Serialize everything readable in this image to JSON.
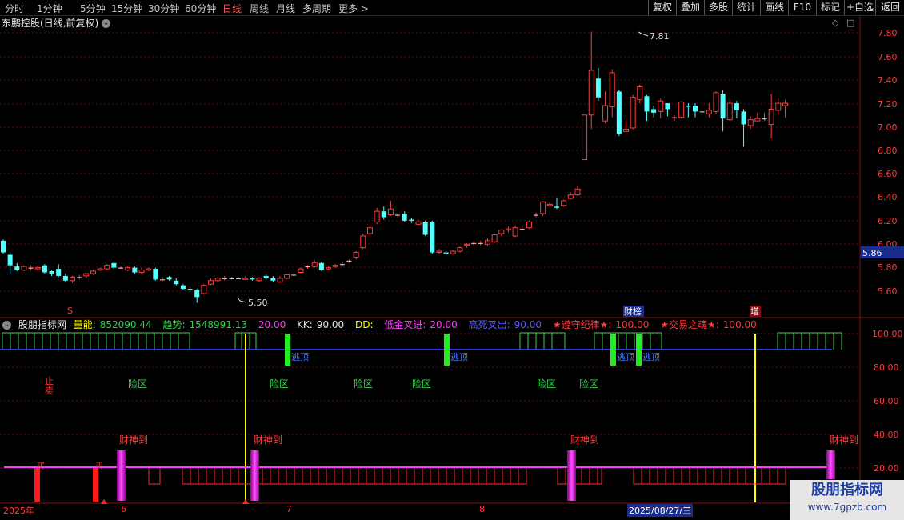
{
  "topbar": {
    "periods": [
      "分时",
      "1分钟",
      "5分钟",
      "15分钟",
      "30分钟",
      "60分钟",
      "日线",
      "周线",
      "月线",
      "多周期",
      "更多 >"
    ],
    "active_period": "日线",
    "buttons": [
      "复权",
      "叠加",
      "多股",
      "统计",
      "画线",
      "F10",
      "标记",
      "+自选",
      "返回"
    ]
  },
  "title": {
    "stock": "东鹏控股(日线,前复权)"
  },
  "price_axis": [
    "7.80",
    "7.60",
    "7.40",
    "7.20",
    "7.00",
    "6.80",
    "6.60",
    "6.40",
    "6.20",
    "6.00",
    "5.80",
    "5.60"
  ],
  "current_price": "5.86",
  "annotations": {
    "high": "7.81",
    "low": "5.50",
    "mark_s": "S",
    "tag_caibang": "财榜",
    "tag_zeng": "增"
  },
  "indicator": {
    "name": "股朋指标网",
    "items": [
      {
        "label": "量能:",
        "value": "852090.44"
      },
      {
        "label": "趋势:",
        "value": "1548991.13"
      },
      {
        "label": "",
        "value": "20.00"
      },
      {
        "label": "KK:",
        "value": "90.00"
      },
      {
        "label": "DD:",
        "value": ""
      },
      {
        "label": "低金叉进:",
        "value": "20.00"
      },
      {
        "label": "高死叉出:",
        "value": "90.00"
      },
      {
        "label": "★遵守纪律★:",
        "value": "100.00"
      },
      {
        "label": "★交易之魂★:",
        "value": "100.00"
      }
    ],
    "axis": [
      "100.00",
      "80.00",
      "60.00",
      "40.00",
      "20.00"
    ],
    "texts": {
      "risk": "险区",
      "top": "逃顶",
      "stop": "止卖",
      "buy": "买",
      "wealth": "财神到"
    }
  },
  "date_axis": {
    "start": "2025年",
    "m6": "6",
    "m7": "7",
    "m8": "8",
    "cursor": "2025/08/27/三"
  },
  "watermark": {
    "line1": "股朋指标网",
    "line2": "www.7gpzb.com"
  },
  "chart_data": {
    "type": "candlestick",
    "ylim": [
      5.45,
      7.9
    ],
    "candles": [
      [
        6.03,
        5.93,
        6.04,
        5.92
      ],
      [
        5.91,
        5.82,
        5.93,
        5.75
      ],
      [
        5.81,
        5.78,
        5.84,
        5.77
      ],
      [
        5.78,
        5.81,
        5.82,
        5.77
      ],
      [
        5.8,
        5.8,
        5.82,
        5.78
      ],
      [
        5.79,
        5.8,
        5.82,
        5.77
      ],
      [
        5.82,
        5.76,
        5.83,
        5.75
      ],
      [
        5.77,
        5.75,
        5.78,
        5.73
      ],
      [
        5.79,
        5.73,
        5.83,
        5.72
      ],
      [
        5.73,
        5.69,
        5.75,
        5.68
      ],
      [
        5.69,
        5.72,
        5.73,
        5.67
      ],
      [
        5.72,
        5.72,
        5.74,
        5.7
      ],
      [
        5.73,
        5.75,
        5.75,
        5.71
      ],
      [
        5.75,
        5.77,
        5.78,
        5.74
      ],
      [
        5.78,
        5.79,
        5.8,
        5.77
      ],
      [
        5.79,
        5.82,
        5.83,
        5.78
      ],
      [
        5.84,
        5.8,
        5.85,
        5.79
      ],
      [
        5.8,
        5.8,
        5.81,
        5.79
      ],
      [
        5.78,
        5.8,
        5.81,
        5.77
      ],
      [
        5.8,
        5.76,
        5.81,
        5.75
      ],
      [
        5.76,
        5.78,
        5.8,
        5.75
      ],
      [
        5.78,
        5.79,
        5.8,
        5.77
      ],
      [
        5.79,
        5.7,
        5.8,
        5.69
      ],
      [
        5.7,
        5.7,
        5.72,
        5.68
      ],
      [
        5.72,
        5.7,
        5.73,
        5.69
      ],
      [
        5.69,
        5.66,
        5.71,
        5.65
      ],
      [
        5.65,
        5.62,
        5.66,
        5.61
      ],
      [
        5.62,
        5.61,
        5.63,
        5.6
      ],
      [
        5.61,
        5.55,
        5.62,
        5.5
      ],
      [
        5.58,
        5.65,
        5.66,
        5.57
      ],
      [
        5.66,
        5.69,
        5.71,
        5.65
      ],
      [
        5.69,
        5.71,
        5.72,
        5.68
      ],
      [
        5.71,
        5.71,
        5.73,
        5.69
      ],
      [
        5.71,
        5.71,
        5.72,
        5.7
      ],
      [
        5.71,
        5.71,
        5.72,
        5.7
      ],
      [
        5.7,
        5.71,
        5.73,
        5.7
      ],
      [
        5.71,
        5.7,
        5.72,
        5.69
      ],
      [
        5.69,
        5.71,
        5.72,
        5.68
      ],
      [
        5.73,
        5.71,
        5.74,
        5.7
      ],
      [
        5.71,
        5.69,
        5.73,
        5.68
      ],
      [
        5.68,
        5.71,
        5.73,
        5.67
      ],
      [
        5.71,
        5.74,
        5.75,
        5.7
      ],
      [
        5.74,
        5.74,
        5.76,
        5.73
      ],
      [
        5.76,
        5.79,
        5.8,
        5.75
      ],
      [
        5.81,
        5.81,
        5.82,
        5.79
      ],
      [
        5.81,
        5.84,
        5.86,
        5.8
      ],
      [
        5.84,
        5.78,
        5.85,
        5.77
      ],
      [
        5.79,
        5.8,
        5.81,
        5.78
      ],
      [
        5.81,
        5.82,
        5.83,
        5.8
      ],
      [
        5.83,
        5.83,
        5.85,
        5.82
      ],
      [
        5.86,
        5.86,
        5.87,
        5.84
      ],
      [
        5.89,
        5.93,
        5.94,
        5.87
      ],
      [
        5.97,
        6.07,
        6.09,
        5.96
      ],
      [
        6.09,
        6.14,
        6.16,
        6.07
      ],
      [
        6.19,
        6.28,
        6.31,
        6.17
      ],
      [
        6.28,
        6.23,
        6.32,
        6.21
      ],
      [
        6.25,
        6.3,
        6.37,
        6.24
      ],
      [
        6.25,
        6.25,
        6.26,
        6.23
      ],
      [
        6.26,
        6.2,
        6.28,
        6.19
      ],
      [
        6.21,
        6.2,
        6.22,
        6.18
      ],
      [
        6.17,
        6.19,
        6.21,
        6.16
      ],
      [
        6.19,
        6.08,
        6.2,
        6.07
      ],
      [
        6.19,
        5.93,
        6.2,
        5.92
      ],
      [
        5.93,
        5.94,
        5.96,
        5.92
      ],
      [
        5.93,
        5.92,
        5.94,
        5.91
      ],
      [
        5.92,
        5.94,
        5.95,
        5.91
      ],
      [
        5.94,
        5.97,
        5.98,
        5.93
      ],
      [
        5.99,
        6.0,
        6.01,
        5.97
      ],
      [
        6.01,
        6.01,
        6.03,
        5.98
      ],
      [
        6.01,
        6.01,
        6.03,
        5.99
      ],
      [
        6.0,
        6.03,
        6.05,
        5.99
      ],
      [
        6.02,
        6.08,
        6.09,
        6.01
      ],
      [
        6.09,
        6.12,
        6.13,
        6.07
      ],
      [
        6.12,
        6.13,
        6.15,
        6.1
      ],
      [
        6.07,
        6.14,
        6.16,
        6.06
      ],
      [
        6.13,
        6.13,
        6.15,
        6.12
      ],
      [
        6.14,
        6.19,
        6.2,
        6.13
      ],
      [
        6.25,
        6.25,
        6.27,
        6.23
      ],
      [
        6.26,
        6.36,
        6.37,
        6.24
      ],
      [
        6.33,
        6.34,
        6.36,
        6.31
      ],
      [
        6.32,
        6.31,
        6.39,
        6.3
      ],
      [
        6.33,
        6.37,
        6.38,
        6.32
      ],
      [
        6.39,
        6.42,
        6.44,
        6.38
      ],
      [
        6.42,
        6.47,
        6.5,
        6.41
      ],
      [
        6.72,
        7.1,
        7.1,
        6.72
      ],
      [
        7.1,
        7.48,
        7.81,
        6.98
      ],
      [
        7.41,
        7.25,
        7.5,
        7.22
      ],
      [
        7.05,
        7.18,
        7.3,
        7.03
      ],
      [
        7.17,
        7.46,
        7.49,
        7.08
      ],
      [
        7.3,
        6.94,
        7.31,
        6.92
      ],
      [
        6.96,
        6.98,
        7.06,
        6.96
      ],
      [
        6.99,
        7.25,
        7.27,
        6.98
      ],
      [
        7.23,
        7.34,
        7.36,
        7.2
      ],
      [
        7.26,
        7.13,
        7.27,
        7.05
      ],
      [
        7.15,
        7.12,
        7.18,
        7.08
      ],
      [
        7.13,
        7.22,
        7.24,
        7.07
      ],
      [
        7.2,
        7.15,
        7.2,
        7.09
      ],
      [
        7.08,
        7.08,
        7.1,
        7.05
      ],
      [
        7.08,
        7.21,
        7.22,
        7.07
      ],
      [
        7.18,
        7.17,
        7.2,
        7.08
      ],
      [
        7.18,
        7.13,
        7.2,
        7.08
      ],
      [
        7.13,
        7.13,
        7.15,
        7.12
      ],
      [
        7.11,
        7.14,
        7.2,
        7.08
      ],
      [
        7.13,
        7.29,
        7.3,
        7.11
      ],
      [
        7.28,
        7.07,
        7.31,
        6.96
      ],
      [
        7.06,
        7.2,
        7.23,
        7.05
      ],
      [
        7.2,
        7.14,
        7.22,
        7.07
      ],
      [
        7.13,
        7.02,
        7.15,
        6.83
      ],
      [
        7.01,
        7.06,
        7.09,
        6.98
      ],
      [
        7.05,
        7.07,
        7.12,
        7.05
      ],
      [
        7.07,
        7.07,
        7.12,
        7.05
      ],
      [
        7.02,
        7.15,
        7.28,
        6.9
      ],
      [
        7.14,
        7.2,
        7.24,
        7.1
      ],
      [
        7.18,
        7.2,
        7.23,
        7.08
      ]
    ]
  }
}
